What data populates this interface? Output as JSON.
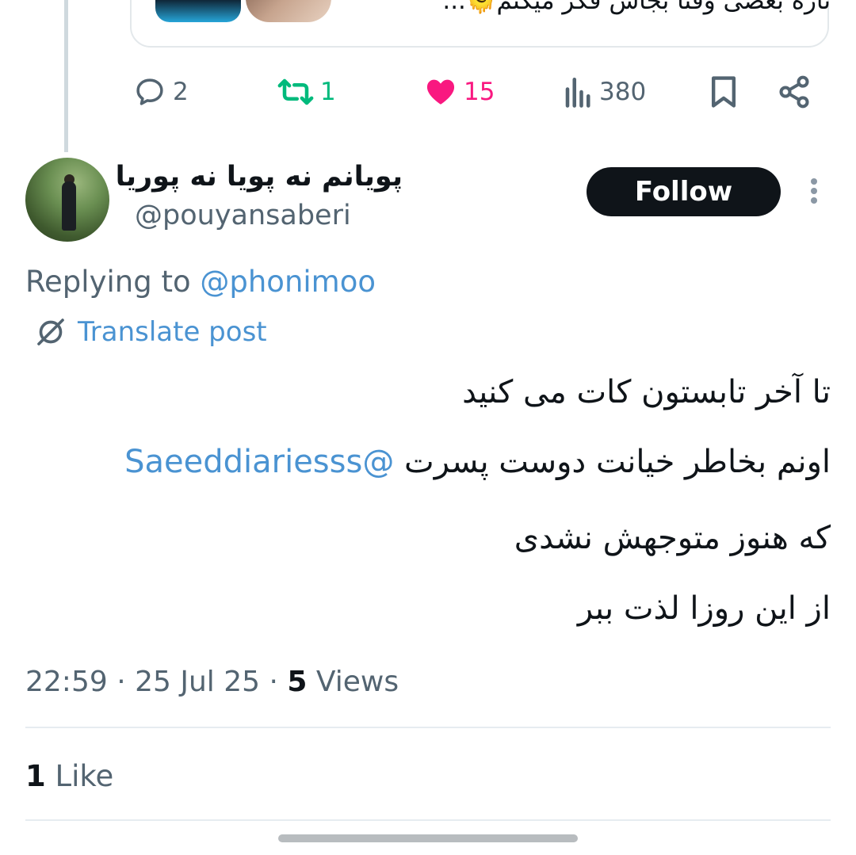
{
  "quoted": {
    "text": "تازه بعضی وقتا بجاش فکر میکنم🫠..."
  },
  "actions": {
    "replies": "2",
    "reposts": "1",
    "likes": "15",
    "views": "380"
  },
  "colors": {
    "repost": "#00ba7c",
    "like": "#f91880",
    "link": "#4a93d2",
    "muted": "#536471"
  },
  "post": {
    "display_name": "پویانم نه پویا نه پوریا",
    "handle": "@pouyansaberi",
    "follow_label": "Follow",
    "replying_label": "Replying to",
    "replying_mention": "@phonimoo",
    "translate_label": "Translate post",
    "lines": [
      "تا آخر تابستون کات می کنید",
      "اونم بخاطر خیانت دوست پسرت",
      "که هنوز متوجهش نشدی",
      "از این روزا لذت ببر"
    ],
    "inline_mention": "@Saeeddiariesss",
    "time": "22:59",
    "date": "25 Jul 25",
    "views_count": "5",
    "views_label": "Views",
    "like_count": "1",
    "like_label": "Like"
  }
}
